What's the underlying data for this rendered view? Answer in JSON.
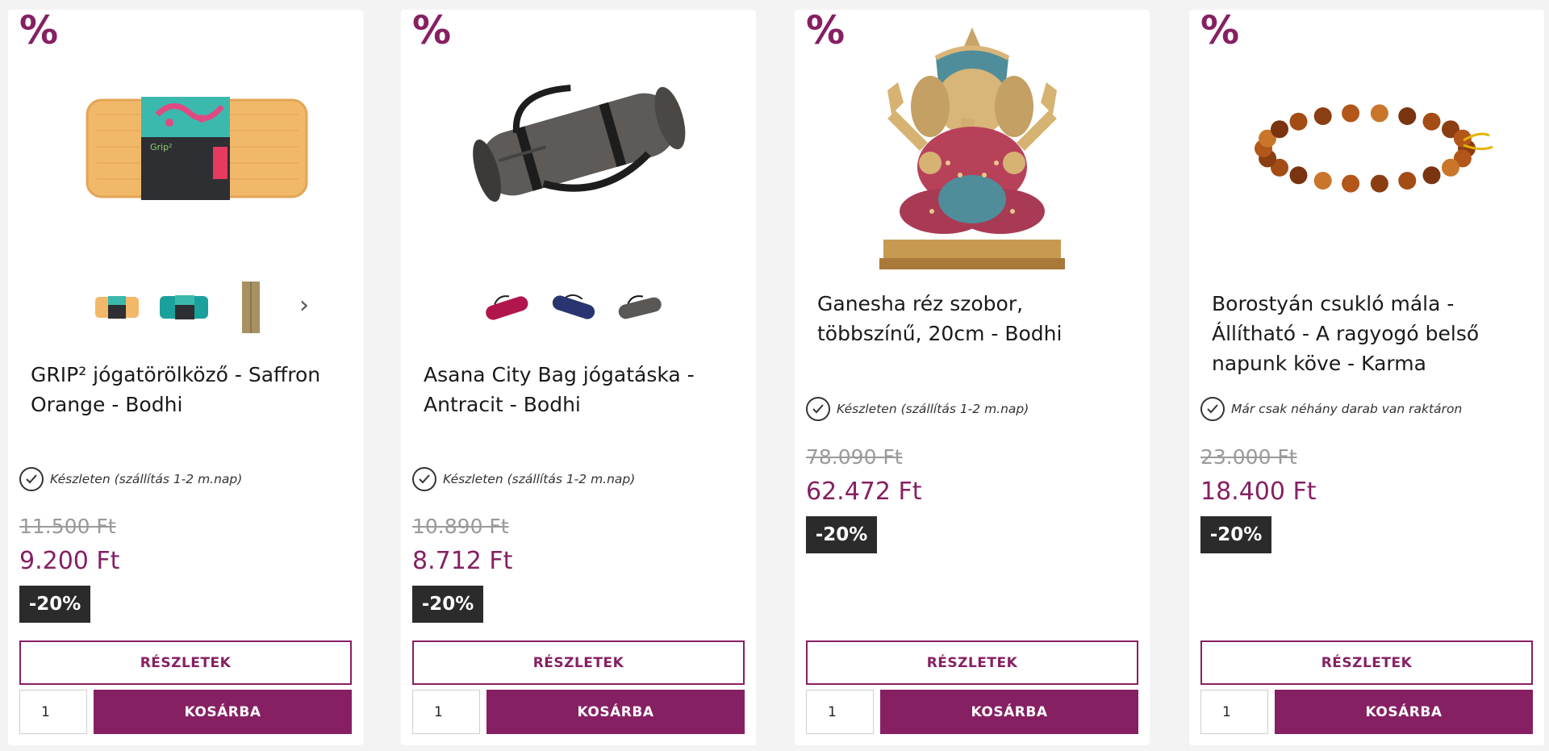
{
  "products": [
    {
      "badge": "%",
      "title": "GRIP² jógatörölköző - Saffron Orange - Bodhi",
      "stock": "Készleten (szállítás 1-2 m.nap)",
      "old_price": "11.500 Ft",
      "new_price": "9.200 Ft",
      "discount": "-20%",
      "details_label": "RÉSZLETEK",
      "qty": "1",
      "cart_label": "KOSÁRBA",
      "image_icon": "rolled-yoga-towel-image",
      "packaging_label": "Grip²",
      "thumbnails": [
        "orange-towel-thumb",
        "teal-towel-thumb",
        "folded-towel-thumb"
      ]
    },
    {
      "badge": "%",
      "title": "Asana City Bag jógatáska - Antracit - Bodhi",
      "stock": "Készleten (szállítás 1-2 m.nap)",
      "old_price": "10.890 Ft",
      "new_price": "8.712 Ft",
      "discount": "-20%",
      "details_label": "RÉSZLETEK",
      "qty": "1",
      "cart_label": "KOSÁRBA",
      "image_icon": "yoga-bag-image",
      "thumbnails": [
        "magenta-bag-thumb",
        "navy-bag-thumb",
        "grey-bag-thumb"
      ]
    },
    {
      "badge": "%",
      "title": "Ganesha réz szobor, többszínű, 20cm - Bodhi",
      "stock": "Készleten (szállítás 1-2 m.nap)",
      "old_price": "78.090 Ft",
      "new_price": "62.472 Ft",
      "discount": "-20%",
      "details_label": "RÉSZLETEK",
      "qty": "1",
      "cart_label": "KOSÁRBA",
      "image_icon": "ganesha-statue-image"
    },
    {
      "badge": "%",
      "title": "Borostyán csukló mála - Állítható - A ragyogó belső napunk köve - Karma",
      "stock": "Már csak néhány darab van raktáron",
      "old_price": "23.000 Ft",
      "new_price": "18.400 Ft",
      "discount": "-20%",
      "details_label": "RÉSZLETEK",
      "qty": "1",
      "cart_label": "KOSÁRBA",
      "image_icon": "amber-bracelet-image"
    }
  ],
  "colors": {
    "accent": "#862063",
    "badge_bg": "#2b2b2b",
    "old_price": "#9a9a9a",
    "page_bg": "#f3f3f3"
  },
  "icons": {
    "stock": "check-circle-icon",
    "next": "chevron-right-icon"
  }
}
